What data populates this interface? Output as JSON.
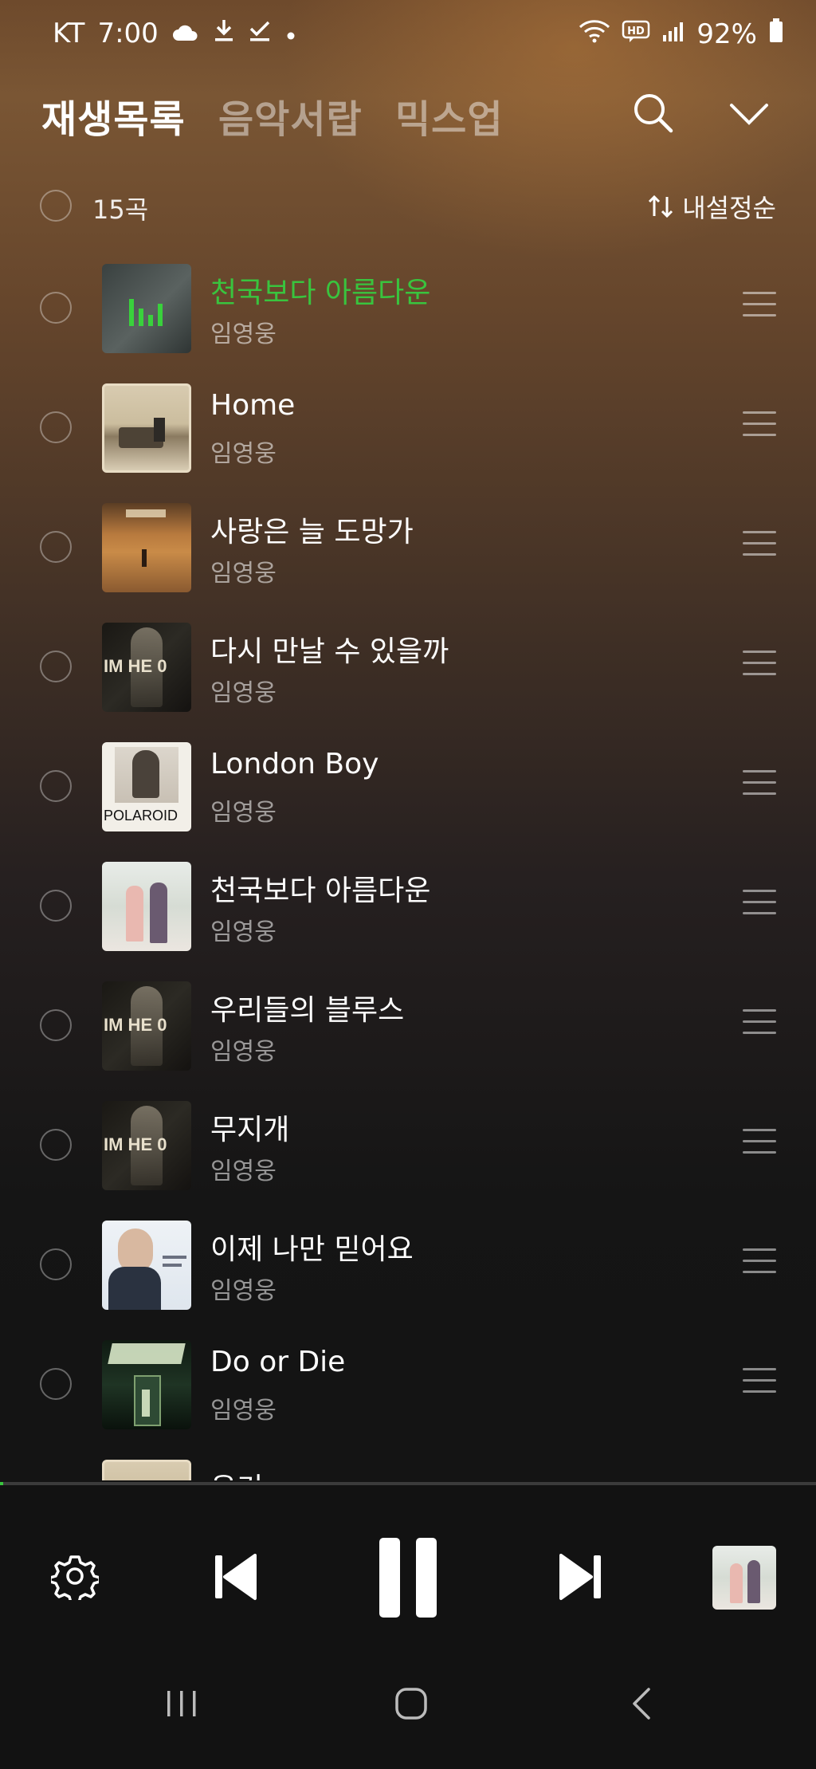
{
  "status_bar": {
    "carrier": "KT",
    "time": "7:00",
    "battery": "92%",
    "icons": [
      "cloud-icon",
      "download-icon",
      "check-download-icon",
      "dot-icon",
      "wifi-icon",
      "hd-call-icon",
      "signal-icon",
      "battery-icon"
    ]
  },
  "header": {
    "tabs": [
      {
        "label": "재생목록",
        "active": true
      },
      {
        "label": "음악서랍",
        "active": false
      },
      {
        "label": "믹스업",
        "active": false
      }
    ],
    "search_icon": "search-icon",
    "collapse_icon": "chevron-down-icon"
  },
  "list_header": {
    "count": "15곡",
    "sort_label": "내설정순"
  },
  "tracks": [
    {
      "title": "천국보다 아름다운",
      "artist": "임영웅",
      "playing": true
    },
    {
      "title": "Home",
      "artist": "임영웅"
    },
    {
      "title": "사랑은 늘 도망가",
      "artist": "임영웅"
    },
    {
      "title": "다시 만날 수 있을까",
      "artist": "임영웅"
    },
    {
      "title": "London Boy",
      "artist": "임영웅",
      "art_text": "POLAROID"
    },
    {
      "title": "천국보다 아름다운",
      "artist": "임영웅"
    },
    {
      "title": "우리들의 블루스",
      "artist": "임영웅"
    },
    {
      "title": "무지개",
      "artist": "임영웅"
    },
    {
      "title": "이제 나만 믿어요",
      "artist": "임영웅"
    },
    {
      "title": "Do or Die",
      "artist": "임영웅"
    },
    {
      "title": "온기",
      "artist": ""
    }
  ],
  "player": {
    "progress": 0.004,
    "controls": [
      "settings-icon",
      "previous-icon",
      "pause-icon",
      "next-icon"
    ]
  },
  "colors": {
    "accent": "#39c43e",
    "background_bottom": "#121212"
  },
  "navigation_bar": [
    "recent-apps-icon",
    "home-icon",
    "back-icon"
  ]
}
